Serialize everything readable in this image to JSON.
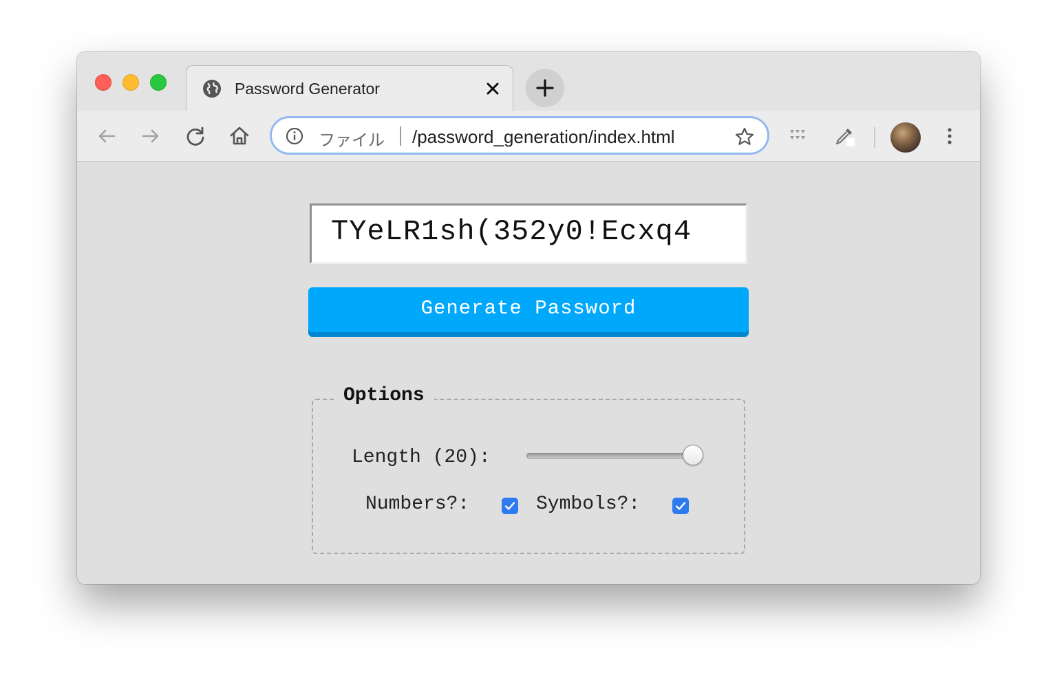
{
  "browser": {
    "tab_title": "Password Generator",
    "address_scheme_label": "ファイル",
    "address_url": "/password_generation/index.html"
  },
  "page": {
    "password": "TYeLR1sh(352y0!Ecxq4",
    "generate_button_label": "Generate Password",
    "options_legend": "Options",
    "length_label": "Length (20):",
    "length_value": 20,
    "length_slider_fraction": 1.0,
    "numbers_label": "Numbers?:",
    "numbers_checked": true,
    "symbols_label": "Symbols?:",
    "symbols_checked": true
  },
  "colors": {
    "button_bg": "#00a8fc",
    "checkbox": "#2e7bf0",
    "focus_ring": "#93b9ef"
  }
}
